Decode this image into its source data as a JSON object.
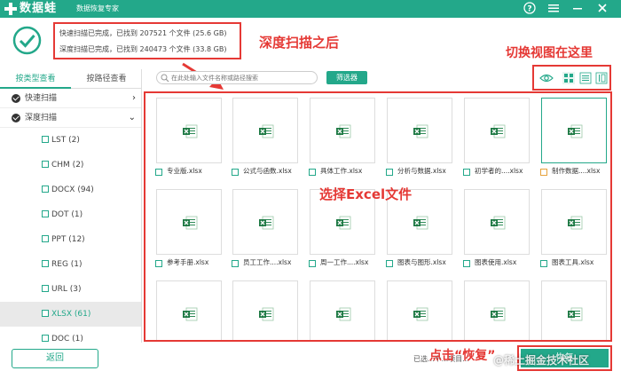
{
  "app": {
    "name": "数据蛙",
    "subtitle": "数据恢复专家"
  },
  "scan": {
    "quick_line": "快速扫描已完成，已找到 207521 个文件 (25.6 GB)",
    "deep_line": "深度扫描已完成，已找到 240473 个文件 (33.8 GB)"
  },
  "annotations": {
    "after_deep_scan": "深度扫描之后",
    "switch_view": "切换视图在这里",
    "select_excel": "选择Excel文件",
    "click_recover": "点击“恢复”"
  },
  "left_panel": {
    "tabs": [
      {
        "label": "按类型查看",
        "active": true
      },
      {
        "label": "按路径查看",
        "active": false
      }
    ],
    "tree": [
      {
        "label": "快速扫描",
        "arrow": "›"
      },
      {
        "label": "深度扫描",
        "arrow": "⌄"
      }
    ],
    "extensions": [
      {
        "label": "LST (2)",
        "selected": false
      },
      {
        "label": "CHM (2)",
        "selected": false
      },
      {
        "label": "DOCX (94)",
        "selected": false
      },
      {
        "label": "DOT (1)",
        "selected": false
      },
      {
        "label": "PPT (12)",
        "selected": false
      },
      {
        "label": "REG (1)",
        "selected": false
      },
      {
        "label": "URL (3)",
        "selected": false
      },
      {
        "label": "XLSX (61)",
        "selected": true
      },
      {
        "label": "DOC (1)",
        "selected": false
      }
    ]
  },
  "toolbar": {
    "search_placeholder": "在此处输入文件名称或路径搜索",
    "filter_label": "筛选器"
  },
  "files": [
    {
      "name": "专业版.xlsx",
      "highlight": false
    },
    {
      "name": "公式与函数.xlsx",
      "highlight": false
    },
    {
      "name": "具体工作.xlsx",
      "highlight": false
    },
    {
      "name": "分析与数据.xlsx",
      "highlight": false
    },
    {
      "name": "初学者的....xlsx",
      "highlight": false
    },
    {
      "name": "制作数据....xlsx",
      "highlight": true
    },
    {
      "name": "参考手册.xlsx",
      "highlight": false
    },
    {
      "name": "员工工作....xlsx",
      "highlight": false
    },
    {
      "name": "周一工作....xlsx",
      "highlight": false
    },
    {
      "name": "图表与图形.xlsx",
      "highlight": false
    },
    {
      "name": "图表使用.xlsx",
      "highlight": false
    },
    {
      "name": "图表工具.xlsx",
      "highlight": false
    },
    {
      "name": "",
      "highlight": false
    },
    {
      "name": "",
      "highlight": false
    },
    {
      "name": "",
      "highlight": false
    },
    {
      "name": "",
      "highlight": false
    },
    {
      "name": "",
      "highlight": false
    },
    {
      "name": "",
      "highlight": false
    }
  ],
  "bottom": {
    "back_label": "返回",
    "selected_text": "已选...个...项目...",
    "recover_label": "恢复",
    "watermark": "@稀土掘金技术社区"
  },
  "colors": {
    "accent": "#23a88a",
    "annotation": "#e53935"
  },
  "icons": {
    "logo": "frog-plus-icon",
    "help": "help-icon",
    "menu": "menu-icon",
    "minimize": "minimize-icon",
    "close": "close-icon",
    "scan_done": "check-circle-icon",
    "search": "search-icon",
    "preview": "eye-icon",
    "grid_view": "grid-view-icon",
    "list_view": "list-view-icon",
    "detail_view": "detail-view-icon",
    "excel": "excel-icon"
  }
}
